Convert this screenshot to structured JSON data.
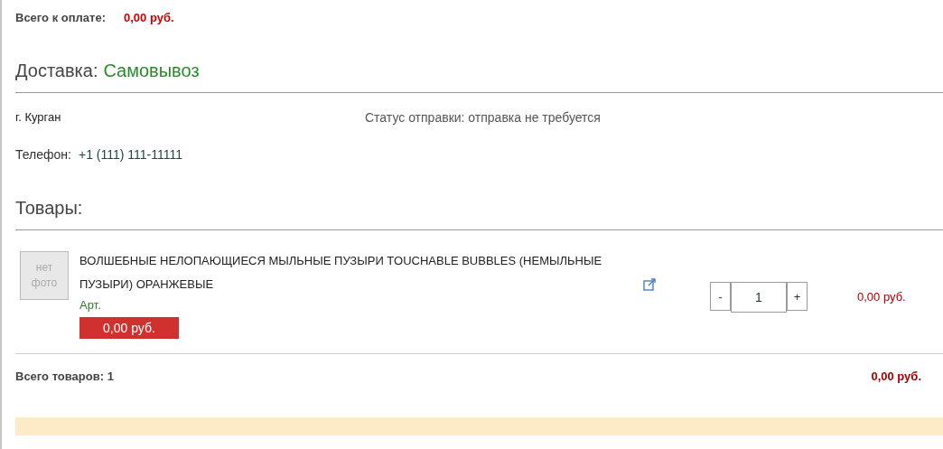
{
  "payment_total": {
    "label": "Всего к оплате:",
    "value": "0,00 руб."
  },
  "delivery": {
    "label": "Доставка:",
    "method": "Самовывоз",
    "city": "г. Курган",
    "status": "Статус отправки: отправка не требуется",
    "phone_label": "Телефон:",
    "phone": "+1 (111) 111-11111"
  },
  "goods": {
    "title": "Товары:",
    "items": [
      {
        "photo_placeholder": "нет фото",
        "name": "ВОЛШЕБНЫЕ НЕЛОПАЮЩИЕСЯ МЫЛЬНЫЕ ПУЗЫРИ TOUCHABLE BUBBLES (НЕМЫЛЬНЫЕ ПУЗЫРИ) ОРАНЖЕВЫЕ",
        "article": "Арт.",
        "price": "0,00 руб.",
        "minus": "-",
        "quantity": "1",
        "plus": "+",
        "sum": "0,00 руб."
      }
    ],
    "total_label": "Всего товаров: 1",
    "total_value": "0,00 руб."
  }
}
